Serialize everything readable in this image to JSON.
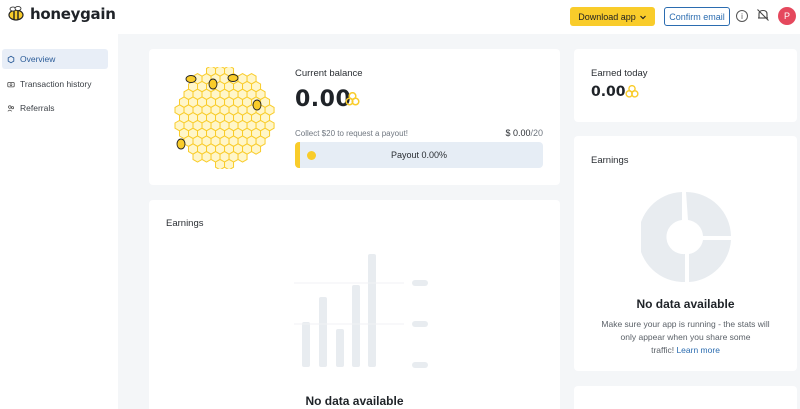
{
  "brand": {
    "name": "honeygain"
  },
  "header": {
    "download_label": "Download app",
    "confirm_label": "Confirm email",
    "avatar_initial": "P"
  },
  "sidebar": {
    "items": [
      {
        "label": "Overview",
        "icon": "hexagon-icon",
        "active": true
      },
      {
        "label": "Transaction history",
        "icon": "wallet-icon",
        "active": false
      },
      {
        "label": "Referrals",
        "icon": "people-icon",
        "active": false
      }
    ]
  },
  "balance": {
    "title": "Current balance",
    "amount": "0.00",
    "payout_hint": "Collect $20 to request a payout!",
    "payout_amount": "$ 0.00",
    "payout_target": "/20",
    "progress_label": "Payout 0.00%",
    "progress_fraction": 0.0
  },
  "earned_today": {
    "title": "Earned today",
    "amount": "0.00"
  },
  "earnings_chart_card": {
    "title": "Earnings",
    "no_data": "No data available"
  },
  "earnings_donut_card": {
    "title": "Earnings",
    "no_data": "No data available",
    "desc_line1": "Make sure your app is running - the stats will",
    "desc_line2": "only appear when you share some",
    "desc_line3": "traffic!",
    "learn_more": "Learn more"
  },
  "colors": {
    "accent": "#f9cc2a",
    "link": "#2b6cb0",
    "avatar": "#e5485d",
    "placeholder": "#e8ecf0"
  }
}
